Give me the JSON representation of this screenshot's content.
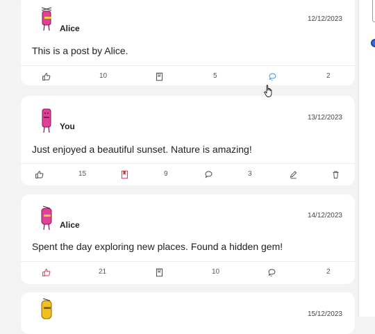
{
  "posts": [
    {
      "author": "Alice",
      "date": "12/12/2023",
      "text": "This is a post by Alice.",
      "likes": "10",
      "bookmarks": "5",
      "comments": "2",
      "liked": false,
      "bookmarked": false,
      "comment_active": true,
      "own": false,
      "avatar_color": "#e0409a"
    },
    {
      "author": "You",
      "date": "13/12/2023",
      "text": "Just enjoyed a beautiful sunset. Nature is amazing!",
      "likes": "15",
      "bookmarks": "9",
      "comments": "3",
      "liked": false,
      "bookmarked": true,
      "comment_active": false,
      "own": true,
      "avatar_color": "#e0409a"
    },
    {
      "author": "Alice",
      "date": "14/12/2023",
      "text": "Spent the day exploring new places. Found a hidden gem!",
      "likes": "21",
      "bookmarks": "10",
      "comments": "2",
      "liked": true,
      "bookmarked": false,
      "comment_active": false,
      "own": false,
      "avatar_color": "#e0409a"
    },
    {
      "author": "",
      "date": "15/12/2023",
      "text": "",
      "avatar_color": "#f0c020"
    }
  ],
  "colors": {
    "active_red": "#d32f4f",
    "active_blue": "#3a8fd8",
    "icon_gray": "#444444"
  },
  "icons": [
    "thumbs-up-icon",
    "bookmark-icon",
    "comment-icon",
    "edit-icon",
    "trash-icon"
  ]
}
